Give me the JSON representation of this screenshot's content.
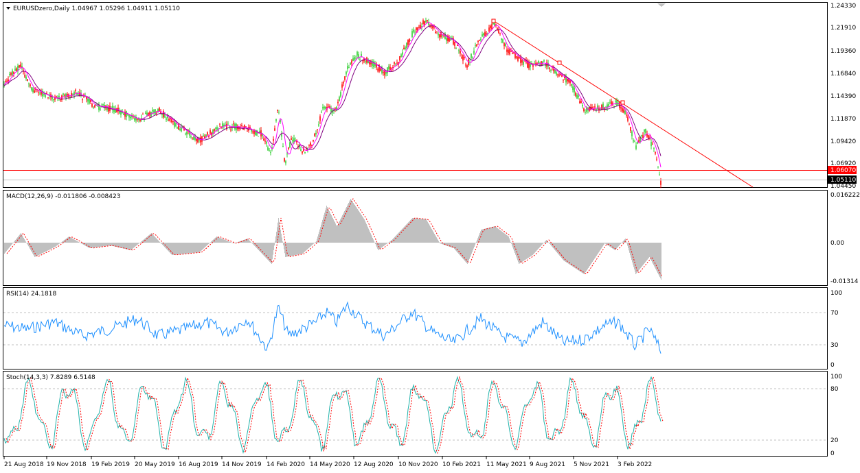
{
  "symbol_header": "EURUSDzero,Daily  1.04967 1.05296 1.04911 1.05110",
  "colors": {
    "bull": "#32cd32",
    "bear": "#ff0000",
    "ma_fast": "#ff00ff",
    "ma_slow": "#800080",
    "trendline": "#ff0000",
    "hline": "#ff0000",
    "macd_hist": "#c0c0c0",
    "macd_signal": "#ff0000",
    "rsi": "#1e90ff",
    "stoch_main": "#20b2aa",
    "stoch_signal": "#ff0000",
    "grid_dash": "#c0c0c0"
  },
  "price_axis": {
    "ticks": [
      "1.24330",
      "1.21910",
      "1.19360",
      "1.16840",
      "1.14390",
      "1.11870",
      "1.09420",
      "1.06920",
      "1.04450"
    ],
    "hline_label": "1.06070",
    "current_label": "1.05110"
  },
  "macd": {
    "label": "MACD(12,26,9) -0.011806 -0.008423",
    "ticks": [
      "0.016222",
      "0.00",
      "-0.01314"
    ]
  },
  "rsi": {
    "label": "RSI(14) 24.1818",
    "ticks": [
      "100",
      "70",
      "30",
      "0"
    ]
  },
  "stoch": {
    "label": "Stoch(14,3,3) 7.8289 6.5148",
    "ticks": [
      "100",
      "80",
      "20",
      "0"
    ]
  },
  "dates": [
    "21 Aug 2018",
    "19 Nov 2018",
    "19 Feb 2019",
    "20 May 2019",
    "16 Aug 2019",
    "14 Nov 2019",
    "14 Feb 2020",
    "14 May 2020",
    "12 Aug 2020",
    "10 Nov 2020",
    "10 Feb 2021",
    "11 May 2021",
    "9 Aug 2021",
    "5 Nov 2021",
    "3 Feb 2022"
  ],
  "chart_data": {
    "type": "line",
    "title": "EURUSDzero,Daily",
    "x": [
      "21 Aug 2018",
      "19 Nov 2018",
      "19 Feb 2019",
      "20 May 2019",
      "16 Aug 2019",
      "14 Nov 2019",
      "14 Feb 2020",
      "14 May 2020",
      "12 Aug 2020",
      "10 Nov 2020",
      "10 Feb 2021",
      "11 May 2021",
      "9 Aug 2021",
      "5 Nov 2021",
      "3 Feb 2022"
    ],
    "series": [],
    "ylim": [
      1.0445,
      1.2433
    ]
  }
}
